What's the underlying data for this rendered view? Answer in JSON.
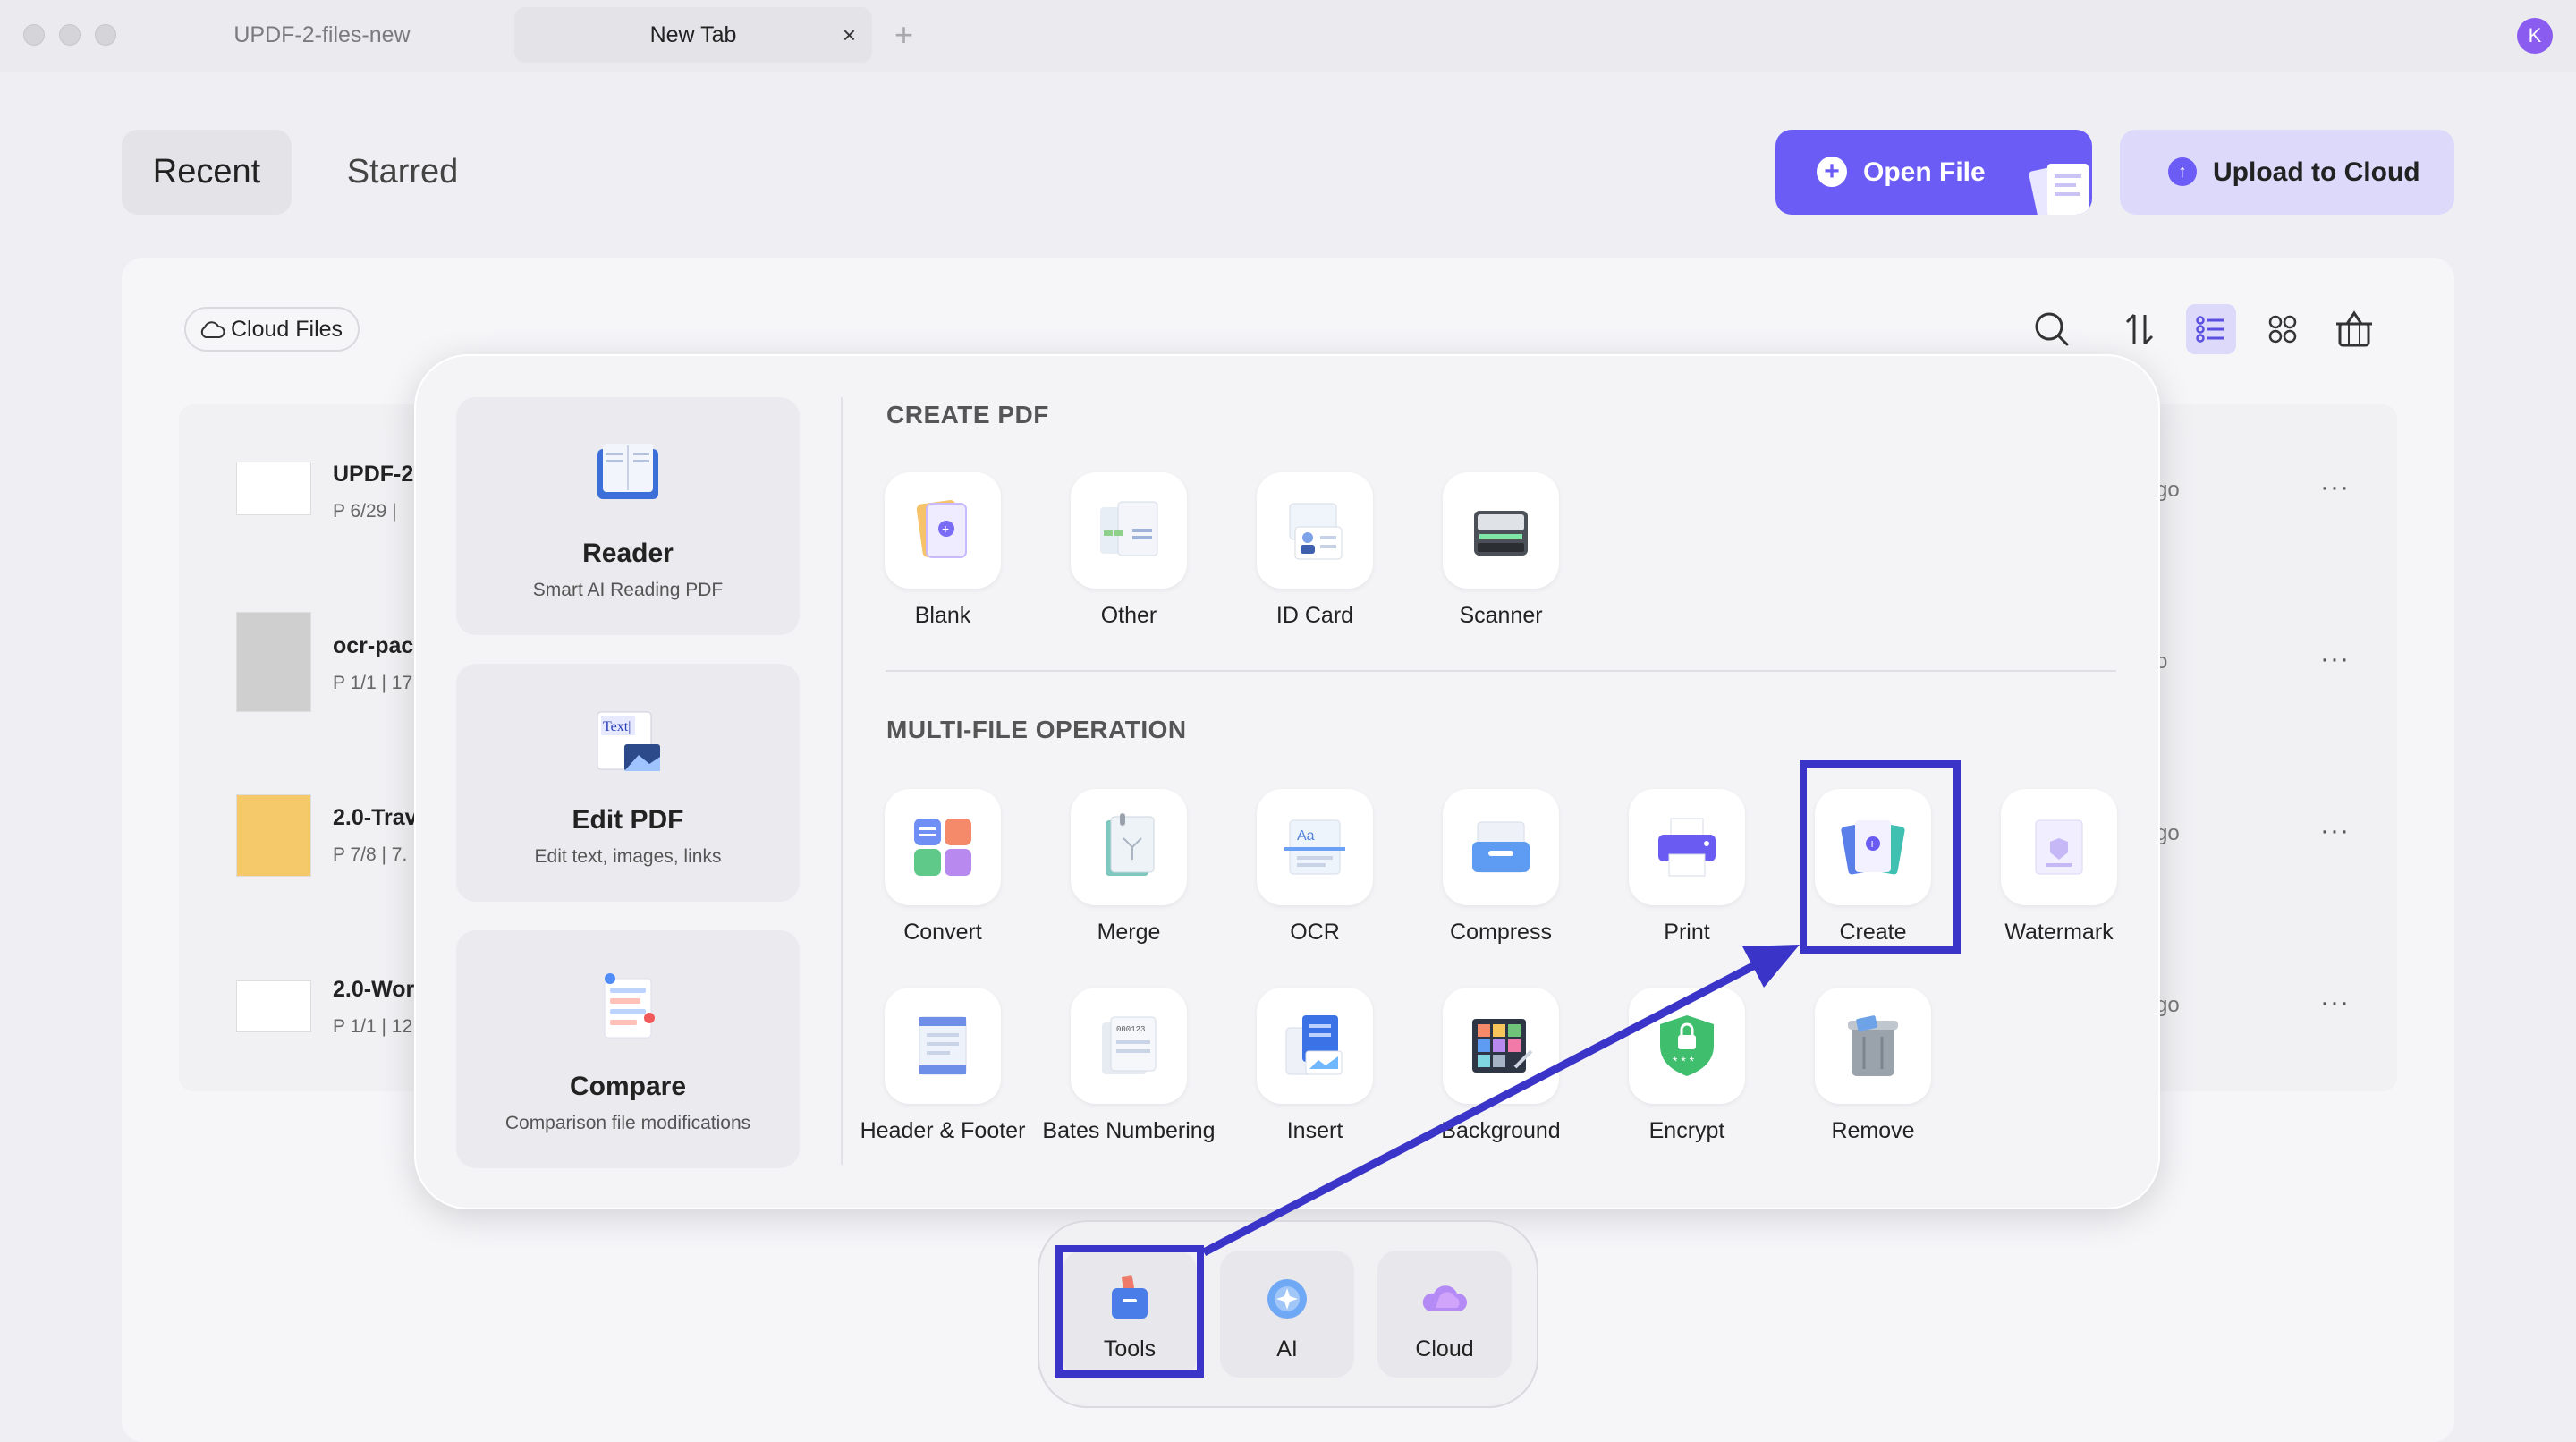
{
  "titlebar": {
    "tabs": [
      {
        "label": "UPDF-2-files-new"
      },
      {
        "label": "New Tab"
      }
    ],
    "close_glyph": "×",
    "add_glyph": "+",
    "avatar_letter": "K"
  },
  "header": {
    "tab_recent": "Recent",
    "tab_starred": "Starred",
    "open_file": "Open File",
    "upload_cloud": "Upload to Cloud"
  },
  "files": {
    "cloud_files": "Cloud Files",
    "rows": [
      {
        "name": "UPDF-2",
        "meta": "P 6/29  |",
        "time": "go"
      },
      {
        "name": "ocr-pac",
        "meta": "P 1/1  |  17",
        "time": "o"
      },
      {
        "name": "2.0-Trav",
        "meta": "P 7/8  |  7.",
        "time": "go"
      },
      {
        "name": "2.0-Wor",
        "meta": "P 1/1  |  12",
        "time": "go"
      }
    ],
    "more_glyph": "···"
  },
  "popup": {
    "side": [
      {
        "title": "Reader",
        "sub": "Smart AI Reading PDF"
      },
      {
        "title": "Edit PDF",
        "sub": "Edit text, images, links"
      },
      {
        "title": "Compare",
        "sub": "Comparison file modifications"
      }
    ],
    "create_title": "CREATE PDF",
    "create_tools": [
      "Blank",
      "Other",
      "ID Card",
      "Scanner"
    ],
    "multi_title": "MULTI-FILE OPERATION",
    "multi_row1": [
      "Convert",
      "Merge",
      "OCR",
      "Compress",
      "Print",
      "Create",
      "Watermark"
    ],
    "multi_row2": [
      "Header & Footer",
      "Bates Numbering",
      "Insert",
      "Background",
      "Encrypt",
      "Remove"
    ]
  },
  "dock": {
    "items": [
      "Tools",
      "AI",
      "Cloud"
    ]
  },
  "colors": {
    "accent": "#6b5cf6",
    "annotation": "#3b34c9"
  }
}
